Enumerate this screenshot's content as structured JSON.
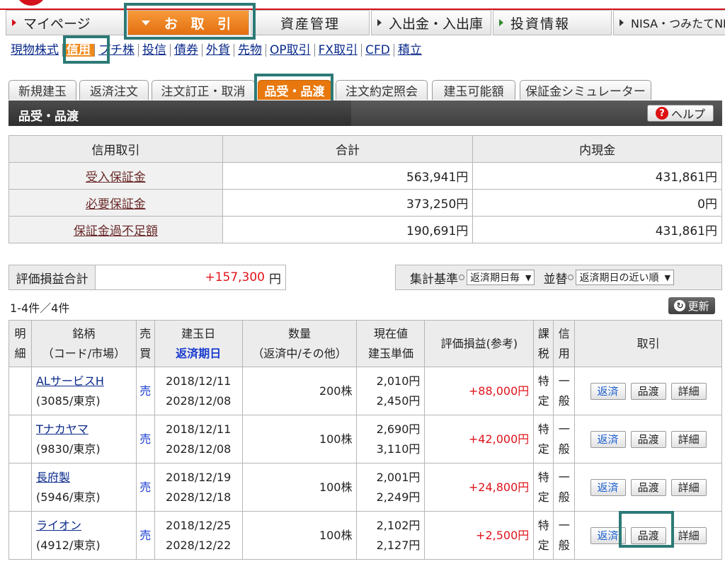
{
  "nav": {
    "items": [
      {
        "label": "マイページ"
      },
      {
        "label": "お 取 引"
      },
      {
        "label": "資産管理"
      },
      {
        "label": "入出金・入出庫"
      },
      {
        "label": "投資情報"
      },
      {
        "label": "NISA・つみたてNISA"
      }
    ]
  },
  "subnav": {
    "items": [
      "現物株式",
      "信用",
      "プチ株",
      "投信",
      "債券",
      "外貨",
      "先物",
      "OP取引",
      "FX取引",
      "CFD",
      "積立"
    ]
  },
  "tabs": [
    "新規建玉",
    "返済注文",
    "注文訂正・取消",
    "品受・品渡",
    "注文約定照会",
    "建玉可能額",
    "保証金シミュレーター"
  ],
  "page": {
    "title": "品受・品渡",
    "help_label": "ヘルプ"
  },
  "margin_summary": {
    "headers": [
      "信用取引",
      "合計",
      "内現金"
    ],
    "rows": [
      {
        "label": "受入保証金",
        "total": "563,941円",
        "cash": "431,861円"
      },
      {
        "label": "必要保証金",
        "total": "373,250円",
        "cash": "0円"
      },
      {
        "label": "保証金過不足額",
        "total": "190,691円",
        "cash": "431,861円"
      }
    ]
  },
  "pnl_total": {
    "label": "評価損益合計",
    "value": "+157,300",
    "unit": "円"
  },
  "filters": {
    "basis_label": "集計基準",
    "basis_value": "返済期日毎",
    "sort_label": "並替",
    "sort_value": "返済期日の近い順"
  },
  "list": {
    "count": "1-4件／4件",
    "refresh_label": "更新"
  },
  "positions_header": {
    "detail": [
      "明",
      "細"
    ],
    "name": [
      "銘柄",
      "（コード/市場）"
    ],
    "side": [
      "売",
      "買"
    ],
    "date": [
      "建玉日",
      "返済期日"
    ],
    "qty": [
      "数量",
      "（返済中/その他）"
    ],
    "price": [
      "現在値",
      "建玉単価"
    ],
    "pnl": "評価損益(参考)",
    "tax": [
      "課",
      "税"
    ],
    "kind": [
      "信",
      "用"
    ],
    "actions": "取引"
  },
  "positions": [
    {
      "name": "ALサービスH",
      "code": "(3085/東京)",
      "side": "売",
      "open_date": "2018/12/11",
      "due_date": "2028/12/08",
      "qty": "200株",
      "current": "2,010円",
      "cost": "2,450円",
      "pnl": "+88,000円",
      "tax": [
        "特",
        "定"
      ],
      "kind": [
        "一",
        "般"
      ]
    },
    {
      "name": "Tナカヤマ",
      "code": "(9830/東京)",
      "side": "売",
      "open_date": "2018/12/11",
      "due_date": "2028/12/08",
      "qty": "100株",
      "current": "2,690円",
      "cost": "3,110円",
      "pnl": "+42,000円",
      "tax": [
        "特",
        "定"
      ],
      "kind": [
        "一",
        "般"
      ]
    },
    {
      "name": "長府製",
      "code": "(5946/東京)",
      "side": "売",
      "open_date": "2018/12/19",
      "due_date": "2028/12/18",
      "qty": "100株",
      "current": "2,001円",
      "cost": "2,249円",
      "pnl": "+24,800円",
      "tax": [
        "特",
        "定"
      ],
      "kind": [
        "一",
        "般"
      ]
    },
    {
      "name": "ライオン",
      "code": "(4912/東京)",
      "side": "売",
      "open_date": "2018/12/25",
      "due_date": "2028/12/22",
      "qty": "100株",
      "current": "2,102円",
      "cost": "2,127円",
      "pnl": "+2,500円",
      "tax": [
        "特",
        "定"
      ],
      "kind": [
        "一",
        "般"
      ]
    }
  ],
  "actions": {
    "repay": "返済",
    "deliver": "品渡",
    "detail": "詳細"
  },
  "colors": {
    "accent": "#e8780e",
    "brand_red": "#d4121b",
    "highlight": "#2c7a77",
    "profit": "#e0141b"
  }
}
